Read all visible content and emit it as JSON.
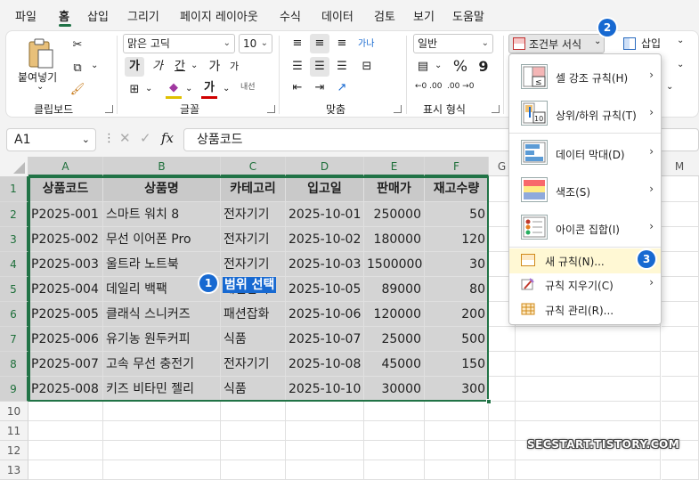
{
  "menu": {
    "tabs": [
      "파일",
      "홈",
      "삽입",
      "그리기",
      "페이지 레이아웃",
      "수식",
      "데이터",
      "검토",
      "보기",
      "도움말"
    ],
    "active": "홈"
  },
  "ribbon": {
    "clipboard": {
      "paste_label": "붙여넣기",
      "group_label": "클립보드"
    },
    "font": {
      "font_name": "맑은 고딕",
      "font_size": "10",
      "bold": "가",
      "italic": "가",
      "underline": "간",
      "grow": "가",
      "small_text": "내선",
      "group_label": "글꼴"
    },
    "alignment": {
      "wrap": "가나",
      "group_label": "맞춤"
    },
    "number": {
      "format": "일반",
      "percent": "%",
      "comma": "9",
      "inc_dec": "←0 .00",
      "dec_dec": ".00 →0",
      "group_label": "표시 형식"
    },
    "styles": {
      "cond_format": "조건부 서식",
      "insert": "삽입"
    }
  },
  "formula_bar": {
    "name_box": "A1",
    "fx": "fx",
    "value": "상품코드"
  },
  "sheet": {
    "columns": [
      "A",
      "B",
      "C",
      "D",
      "E",
      "F",
      "G",
      "H",
      "I",
      "J",
      "K",
      "L",
      "M"
    ],
    "rows": [
      "1",
      "2",
      "3",
      "4",
      "5",
      "6",
      "7",
      "8",
      "9",
      "10",
      "11",
      "12",
      "13"
    ],
    "headers": [
      "상품코드",
      "상품명",
      "카테고리",
      "입고일",
      "판매가",
      "재고수량"
    ],
    "data": [
      [
        "P2025-001",
        "스마트 워치 8",
        "전자기기",
        "2025-10-01",
        "250000",
        "50"
      ],
      [
        "P2025-002",
        "무선 이어폰 Pro",
        "전자기기",
        "2025-10-02",
        "180000",
        "120"
      ],
      [
        "P2025-003",
        "울트라 노트북",
        "전자기기",
        "2025-10-03",
        "1500000",
        "30"
      ],
      [
        "P2025-004",
        "데일리 백팩",
        "패션잡화",
        "2025-10-05",
        "89000",
        "80"
      ],
      [
        "P2025-005",
        "클래식 스니커즈",
        "패션잡화",
        "2025-10-06",
        "120000",
        "200"
      ],
      [
        "P2025-006",
        "유기농 원두커피",
        "식품",
        "2025-10-07",
        "25000",
        "500"
      ],
      [
        "P2025-007",
        "고속 무선 충전기",
        "전자기기",
        "2025-10-08",
        "45000",
        "150"
      ],
      [
        "P2025-008",
        "키즈 비타민 젤리",
        "식품",
        "2025-10-10",
        "30000",
        "300"
      ]
    ]
  },
  "annotations": {
    "badge1": "1",
    "badge2": "2",
    "badge3": "3",
    "range_text": "범위 선택"
  },
  "cf_menu": {
    "items": [
      {
        "label": "셀 강조 규칙(H)",
        "icon": "highlight-cells-icon"
      },
      {
        "label": "상위/하위 규칙(T)",
        "icon": "top-bottom-icon"
      },
      {
        "label": "데이터 막대(D)",
        "icon": "data-bars-icon"
      },
      {
        "label": "색조(S)",
        "icon": "color-scales-icon"
      },
      {
        "label": "아이콘 집합(I)",
        "icon": "icon-sets-icon"
      }
    ],
    "new_rule": "새 규칙(N)...",
    "clear_rules": "규칙 지우기(C)",
    "manage_rules": "규칙 관리(R)...",
    "icon_badge_top": "10",
    "icon_badge_lt": "≤"
  },
  "watermark": "SECSTART.TISTORY.COM",
  "colors": {
    "accent": "#217346",
    "badge": "#1769d1",
    "highlight": "#fff8d4"
  }
}
